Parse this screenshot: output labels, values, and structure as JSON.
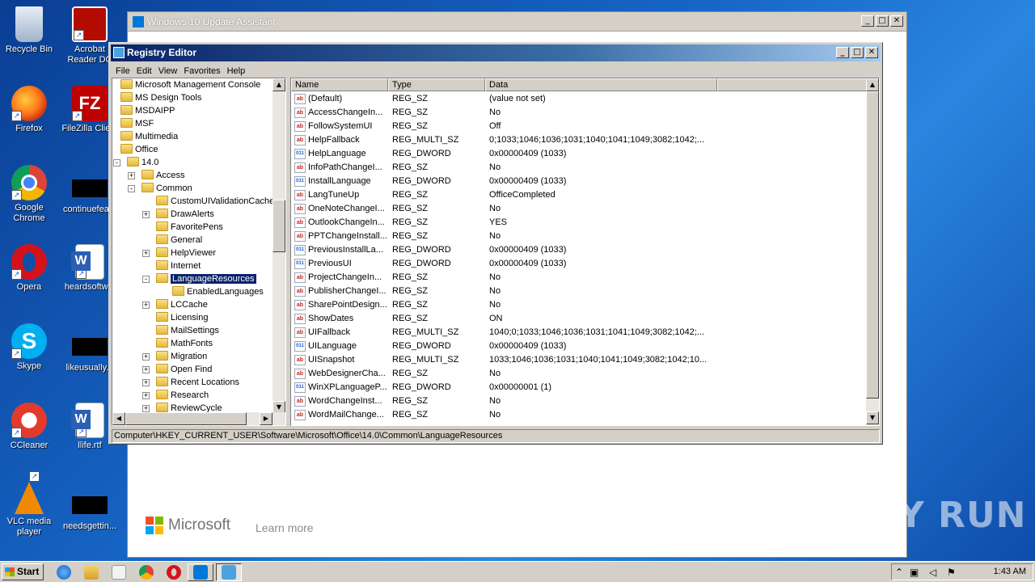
{
  "desktop": {
    "icons": [
      {
        "label": "Recycle Bin",
        "icon": "recycle-bin-icon"
      },
      {
        "label": "Acrobat Reader DC",
        "icon": "acrobat-icon"
      },
      {
        "label": "Firefox",
        "icon": "firefox-icon"
      },
      {
        "label": "FileZilla Client",
        "icon": "filezilla-icon"
      },
      {
        "label": "Google Chrome",
        "icon": "chrome-icon"
      },
      {
        "label": "continuefea...",
        "icon": "blank-file-icon"
      },
      {
        "label": "Opera",
        "icon": "opera-icon"
      },
      {
        "label": "heardsoftw...",
        "icon": "word-doc-icon"
      },
      {
        "label": "Skype",
        "icon": "skype-icon"
      },
      {
        "label": "likeusually...",
        "icon": "blank-file-icon"
      },
      {
        "label": "CCleaner",
        "icon": "ccleaner-icon"
      },
      {
        "label": "llife.rtf",
        "icon": "word-doc-icon"
      },
      {
        "label": "VLC media player",
        "icon": "vlc-icon"
      },
      {
        "label": "needsgettin...",
        "icon": "blank-file-icon"
      }
    ]
  },
  "update_assistant": {
    "title": "Windows 10 Update Assistant",
    "brand": "Microsoft",
    "learn_more": "Learn more"
  },
  "regedit": {
    "title": "Registry Editor",
    "menu": [
      "File",
      "Edit",
      "View",
      "Favorites",
      "Help"
    ],
    "tree": [
      {
        "label": "Microsoft Management Console",
        "level": 0,
        "expander": ""
      },
      {
        "label": "MS Design Tools",
        "level": 0,
        "expander": ""
      },
      {
        "label": "MSDAIPP",
        "level": 0,
        "expander": ""
      },
      {
        "label": "MSF",
        "level": 0,
        "expander": ""
      },
      {
        "label": "Multimedia",
        "level": 0,
        "expander": ""
      },
      {
        "label": "Office",
        "level": 0,
        "expander": ""
      },
      {
        "label": "14.0",
        "level": 1,
        "expander": "-"
      },
      {
        "label": "Access",
        "level": 2,
        "expander": "+"
      },
      {
        "label": "Common",
        "level": 2,
        "expander": "-"
      },
      {
        "label": "CustomUIValidationCache",
        "level": 3,
        "expander": ""
      },
      {
        "label": "DrawAlerts",
        "level": 3,
        "expander": "+"
      },
      {
        "label": "FavoritePens",
        "level": 3,
        "expander": ""
      },
      {
        "label": "General",
        "level": 3,
        "expander": ""
      },
      {
        "label": "HelpViewer",
        "level": 3,
        "expander": "+"
      },
      {
        "label": "Internet",
        "level": 3,
        "expander": ""
      },
      {
        "label": "LanguageResources",
        "level": 3,
        "expander": "-",
        "selected": true
      },
      {
        "label": "EnabledLanguages",
        "level": 4,
        "expander": ""
      },
      {
        "label": "LCCache",
        "level": 3,
        "expander": "+"
      },
      {
        "label": "Licensing",
        "level": 3,
        "expander": ""
      },
      {
        "label": "MailSettings",
        "level": 3,
        "expander": ""
      },
      {
        "label": "MathFonts",
        "level": 3,
        "expander": ""
      },
      {
        "label": "Migration",
        "level": 3,
        "expander": "+"
      },
      {
        "label": "Open Find",
        "level": 3,
        "expander": "+"
      },
      {
        "label": "Recent Locations",
        "level": 3,
        "expander": "+"
      },
      {
        "label": "Research",
        "level": 3,
        "expander": "+"
      },
      {
        "label": "ReviewCycle",
        "level": 3,
        "expander": "+"
      }
    ],
    "columns": [
      "Name",
      "Type",
      "Data"
    ],
    "values": [
      {
        "name": "(Default)",
        "type": "REG_SZ",
        "data": "(value not set)"
      },
      {
        "name": "AccessChangeIn...",
        "type": "REG_SZ",
        "data": "No"
      },
      {
        "name": "FollowSystemUI",
        "type": "REG_SZ",
        "data": "Off"
      },
      {
        "name": "HelpFallback",
        "type": "REG_MULTI_SZ",
        "data": "0;1033;1046;1036;1031;1040;1041;1049;3082;1042;..."
      },
      {
        "name": "HelpLanguage",
        "type": "REG_DWORD",
        "data": "0x00000409 (1033)"
      },
      {
        "name": "InfoPathChangeI...",
        "type": "REG_SZ",
        "data": "No"
      },
      {
        "name": "InstallLanguage",
        "type": "REG_DWORD",
        "data": "0x00000409 (1033)"
      },
      {
        "name": "LangTuneUp",
        "type": "REG_SZ",
        "data": "OfficeCompleted"
      },
      {
        "name": "OneNoteChangeI...",
        "type": "REG_SZ",
        "data": "No"
      },
      {
        "name": "OutlookChangeIn...",
        "type": "REG_SZ",
        "data": "YES"
      },
      {
        "name": "PPTChangeInstall...",
        "type": "REG_SZ",
        "data": "No"
      },
      {
        "name": "PreviousInstallLa...",
        "type": "REG_DWORD",
        "data": "0x00000409 (1033)"
      },
      {
        "name": "PreviousUI",
        "type": "REG_DWORD",
        "data": "0x00000409 (1033)"
      },
      {
        "name": "ProjectChangeIn...",
        "type": "REG_SZ",
        "data": "No"
      },
      {
        "name": "PublisherChangeI...",
        "type": "REG_SZ",
        "data": "No"
      },
      {
        "name": "SharePointDesign...",
        "type": "REG_SZ",
        "data": "No"
      },
      {
        "name": "ShowDates",
        "type": "REG_SZ",
        "data": "ON"
      },
      {
        "name": "UIFallback",
        "type": "REG_MULTI_SZ",
        "data": "1040;0;1033;1046;1036;1031;1041;1049;3082;1042;..."
      },
      {
        "name": "UILanguage",
        "type": "REG_DWORD",
        "data": "0x00000409 (1033)"
      },
      {
        "name": "UISnapshot",
        "type": "REG_MULTI_SZ",
        "data": "1033;1046;1036;1031;1040;1041;1049;3082;1042;10..."
      },
      {
        "name": "WebDesignerCha...",
        "type": "REG_SZ",
        "data": "No"
      },
      {
        "name": "WinXPLanguageP...",
        "type": "REG_DWORD",
        "data": "0x00000001 (1)"
      },
      {
        "name": "WordChangeInst...",
        "type": "REG_SZ",
        "data": "No"
      },
      {
        "name": "WordMailChange...",
        "type": "REG_SZ",
        "data": "No"
      }
    ],
    "status_path": "Computer\\HKEY_CURRENT_USER\\Software\\Microsoft\\Office\\14.0\\Common\\LanguageResources"
  },
  "taskbar": {
    "start_label": "Start",
    "clock": "1:43 AM"
  },
  "watermark": "ANY RUN",
  "colors": {
    "desktop": "#1767c8",
    "title_active": "#0a246a",
    "selection": "#0a246a"
  }
}
